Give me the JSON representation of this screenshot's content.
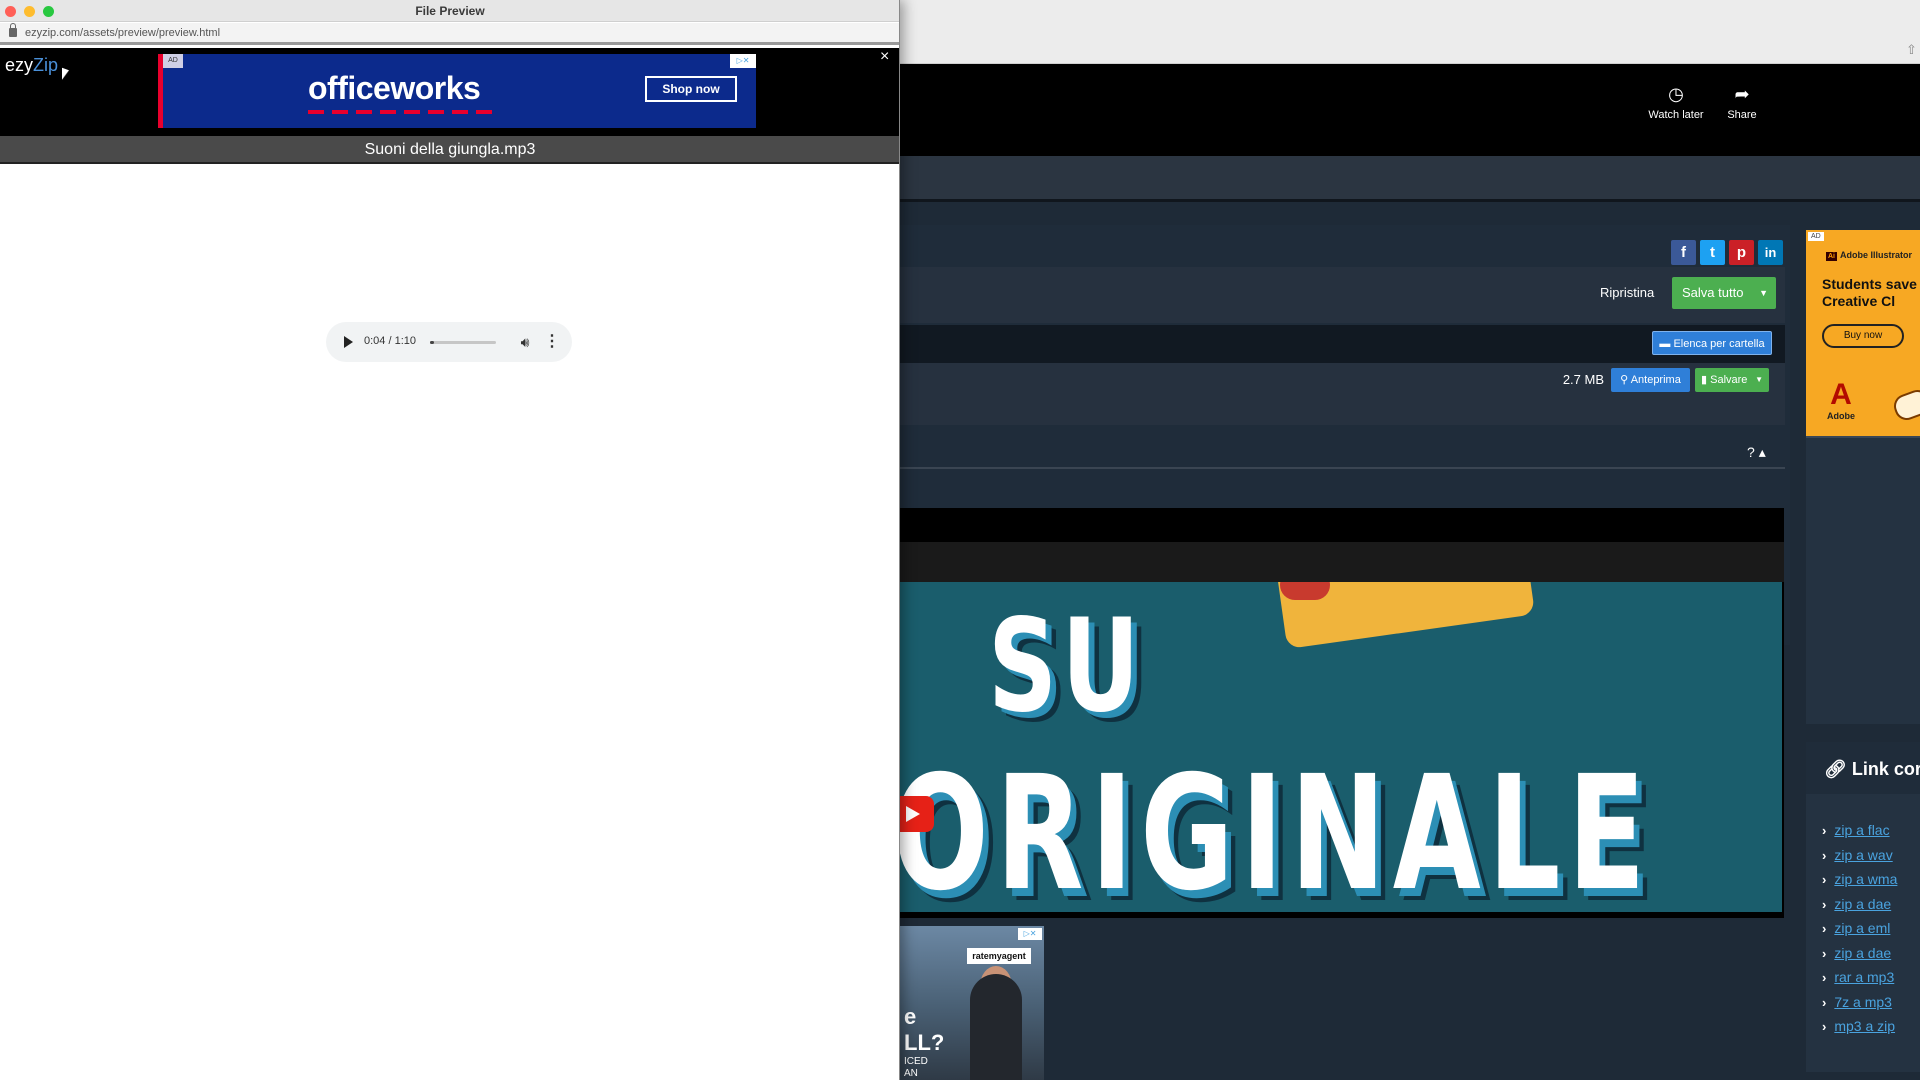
{
  "preview_window": {
    "title": "File Preview",
    "url": "ezyzip.com/assets/preview/preview.html",
    "brand": {
      "part1": "ezy",
      "part2": "Zip"
    },
    "close_glyph": "×",
    "filename": "Suoni della giungla.mp3",
    "ad": {
      "badge": "AD",
      "brand": "officeworks",
      "cta": "Shop now"
    },
    "audio": {
      "time": "0:04 / 1:10",
      "progress": 0.057,
      "play_icon": "play-icon",
      "volume_icon": "volume-icon",
      "menu_icon": "more-vert-icon"
    }
  },
  "background_page": {
    "social": [
      {
        "name": "facebook-icon",
        "glyph": "f",
        "color": "#3b5998"
      },
      {
        "name": "twitter-icon",
        "glyph": "t",
        "color": "#1da1f2"
      },
      {
        "name": "pinterest-icon",
        "glyph": "p",
        "color": "#cb2027"
      },
      {
        "name": "linkedin-icon",
        "glyph": "in",
        "color": "#0077b5"
      }
    ],
    "ripristina": "Ripristina",
    "salva_tutto": "Salva tutto",
    "elenca": "Elenca per cartella",
    "file_size": "2.7 MB",
    "anteprima": "Anteprima",
    "salvare": "Salvare",
    "help": "?",
    "video": {
      "line1": "SU",
      "line2": "ORIGINALE",
      "watch_later": "Watch later",
      "share": "Share"
    },
    "rma_ad": {
      "logo": "ratemyagent",
      "text1": "e",
      "text1b": "LL?",
      "text2": "ICED",
      "text2b": "AN"
    },
    "adobe_ad": {
      "badge": "AD",
      "brand": "Adobe Illustrator",
      "headline": "Students save on Creative Cl",
      "cta": "Buy now",
      "logo_text": "Adobe"
    },
    "links": {
      "title": "Link corr",
      "items": [
        "zip a flac",
        "zip a wav",
        "zip a wma",
        "zip a dae",
        "zip a eml",
        "zip a dae",
        "rar a mp3",
        "7z a mp3",
        "mp3 a zip"
      ]
    }
  },
  "colors": {
    "accent_blue": "#2f7fd8",
    "accent_green": "#4caf50",
    "link": "#4aa3df"
  }
}
